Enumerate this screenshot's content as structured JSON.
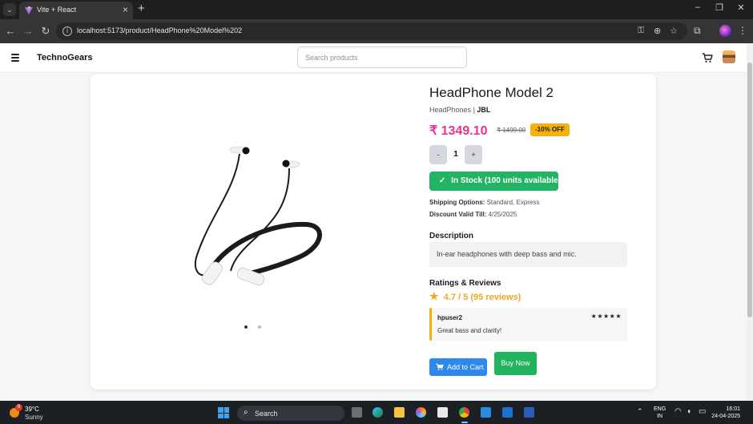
{
  "browser": {
    "tab_title": "Vite + React",
    "url": "localhost:5173/product/HeadPhone%20Model%202",
    "new_tab": "+",
    "tab_close": "×",
    "window_controls": [
      "–",
      "❐",
      "✕"
    ]
  },
  "header": {
    "brand": "TechnoGears",
    "search_placeholder": "Search products"
  },
  "product": {
    "name": "HeadPhone Model 2",
    "category": "HeadPhones",
    "separator": "|",
    "brand": "JBL",
    "price": "₹ 1349.10",
    "original_price": "₹ 1499.00",
    "discount_badge": "-10% OFF",
    "quantity": {
      "minus": "-",
      "value": "1",
      "plus": "+"
    },
    "stock_label": "In Stock (100 units available)",
    "shipping_label": "Shipping Options:",
    "shipping_value": "Standard, Express",
    "discount_valid_label": "Discount Valid Till:",
    "discount_valid_value": "4/25/2025",
    "image_dots": {
      "count": 2,
      "active_index": 0
    }
  },
  "description": {
    "heading": "Description",
    "text": "In-ear headphones with deep bass and mic."
  },
  "ratings": {
    "heading": "Ratings & Reviews",
    "summary": "4.7 / 5 (95 reviews)",
    "reviews": [
      {
        "user": "hpuser2",
        "stars": "★★★★★",
        "text": "Great bass and clarity!"
      }
    ]
  },
  "actions": {
    "add_to_cart": "Add to Cart",
    "buy_now": "Buy Now"
  },
  "taskbar": {
    "weather_temp": "39°C",
    "weather_condition": "Sunny",
    "weather_badge": "9",
    "search_label": "Search",
    "lang_line1": "ENG",
    "lang_line2": "IN",
    "time": "16:01",
    "date": "24-04-2025"
  },
  "colors": {
    "price": "#e7348e",
    "badge": "#f3b10d",
    "stock": "#22b463",
    "add_to_cart": "#2f89ea",
    "buy_now": "#21b35e",
    "rating": "#f0a820"
  }
}
